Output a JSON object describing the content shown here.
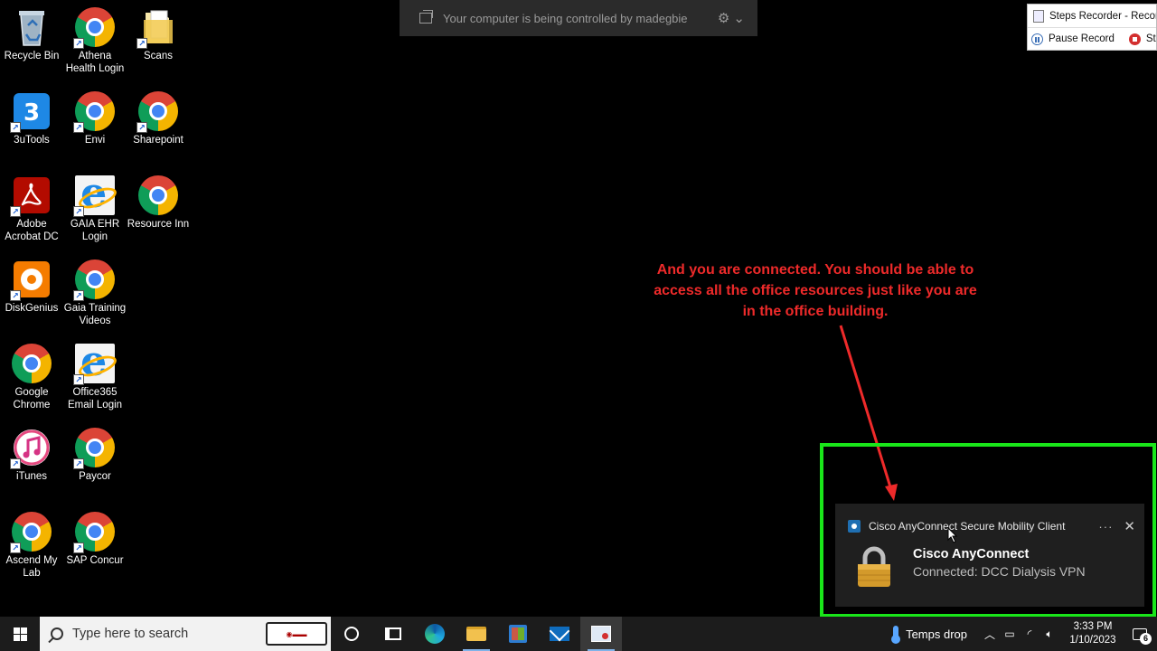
{
  "banner": {
    "text": "Your computer is being controlled by madegbie"
  },
  "steps_recorder": {
    "title": "Steps Recorder - Record",
    "pause_label": "Pause Record",
    "stop_label": "Stop"
  },
  "desktop_icons": [
    {
      "label": "Recycle Bin",
      "icon": "recycle-bin-icon"
    },
    {
      "label": "Athena Health Login",
      "icon": "chrome-icon"
    },
    {
      "label": "Scans",
      "icon": "folder-icon"
    },
    {
      "label": "3uTools",
      "icon": "3utools-icon"
    },
    {
      "label": "Envi",
      "icon": "chrome-icon"
    },
    {
      "label": "Sharepoint",
      "icon": "chrome-icon"
    },
    {
      "label": "Adobe Acrobat DC",
      "icon": "acrobat-icon"
    },
    {
      "label": "GAIA EHR Login",
      "icon": "internet-explorer-icon"
    },
    {
      "label": "Resource Inn",
      "icon": "chrome-icon"
    },
    {
      "label": "DiskGenius",
      "icon": "diskgenius-icon"
    },
    {
      "label": "Gaia Training Videos",
      "icon": "chrome-icon"
    },
    {
      "label": "Google Chrome",
      "icon": "chrome-icon"
    },
    {
      "label": "Office365 Email Login",
      "icon": "internet-explorer-icon"
    },
    {
      "label": "iTunes",
      "icon": "itunes-icon"
    },
    {
      "label": "Paycor",
      "icon": "chrome-icon"
    },
    {
      "label": "Ascend My Lab",
      "icon": "chrome-icon"
    },
    {
      "label": "SAP Concur",
      "icon": "chrome-icon"
    }
  ],
  "annotation": {
    "text": "And you are connected. You should be able to access all the office resources just like you are in the office building.",
    "color": "#ee2a2a",
    "highlight_color": "#19e619"
  },
  "toast": {
    "app_name": "Cisco AnyConnect Secure Mobility Client",
    "title": "Cisco AnyConnect",
    "body": "Connected: DCC Dialysis VPN",
    "more": "···",
    "close": "✕"
  },
  "taskbar": {
    "search_placeholder": "Type here to search",
    "weather": "Temps drop",
    "time": "3:33 PM",
    "date": "1/10/2023",
    "notification_count": "6"
  }
}
